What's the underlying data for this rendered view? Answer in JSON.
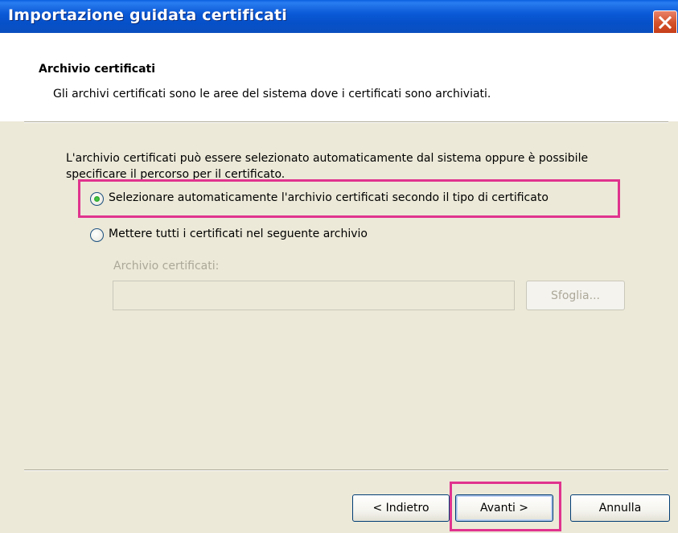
{
  "window": {
    "title": "Importazione guidata certificati"
  },
  "header": {
    "title": "Archivio certificati",
    "subtitle": "Gli archivi certificati sono le aree del sistema dove i certificati sono archiviati."
  },
  "body": {
    "description": "L'archivio certificati può essere selezionato automaticamente dal sistema oppure è possibile specificare il percorso per il certificato.",
    "options": [
      {
        "label": "Selezionare automaticamente l'archivio certificati secondo il tipo di certificato",
        "selected": true
      },
      {
        "label": "Mettere tutti i certificati nel seguente archivio",
        "selected": false
      }
    ],
    "store_field": {
      "label": "Archivio certificati:",
      "value": "",
      "browse_label": "Sfoglia..."
    }
  },
  "footer": {
    "back_label": "< Indietro",
    "next_label": "Avanti >",
    "cancel_label": "Annulla"
  },
  "colors": {
    "titlebar": "#0a55d6",
    "highlight": "#e0338e",
    "window_bg": "#ece9d8"
  },
  "icons": {
    "close": "close-icon"
  }
}
